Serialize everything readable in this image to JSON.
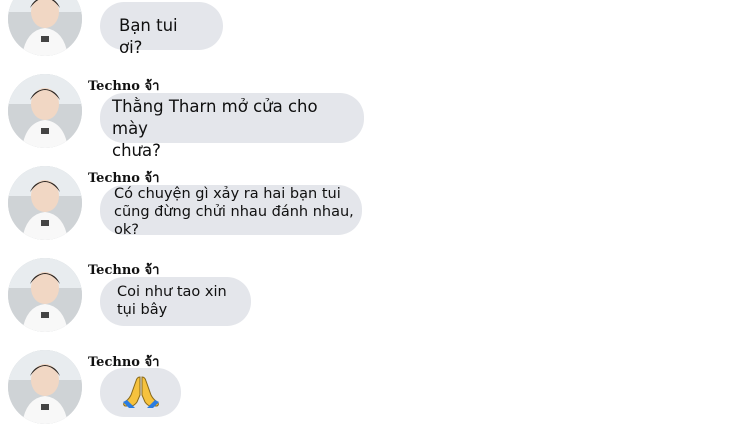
{
  "messages": [
    {
      "sender": "",
      "text": "Bạn tui ơi?"
    },
    {
      "sender": "Techno จ้า",
      "text": "Thằng Tharn mở cửa cho mày\nchưa?"
    },
    {
      "sender": "Techno จ้า",
      "text": "Có chuyện gì xảy ra hai bạn tui\ncũng đừng chửi nhau đánh nhau,\nok?"
    },
    {
      "sender": "Techno จ้า",
      "text": "Coi như tao xin\ntụi bây"
    },
    {
      "sender": "Techno จ้า",
      "text": "",
      "emoji": "folded-hands-icon"
    }
  ],
  "colors": {
    "bubble": "#e4e6eb",
    "text": "#101010",
    "background": "#ffffff"
  }
}
